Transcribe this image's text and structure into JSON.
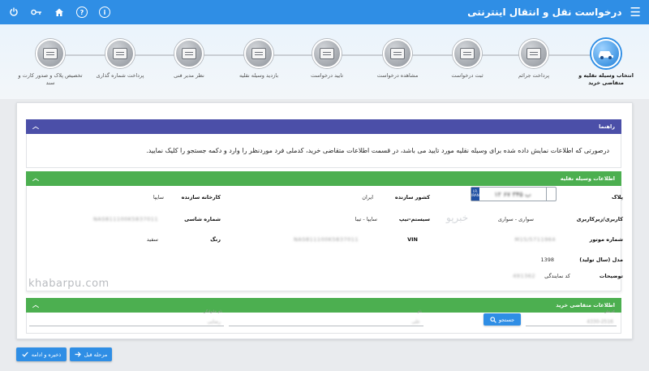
{
  "header": {
    "title": "درخواست نقل و انتقال اینترنتی",
    "menu_icon": "hamburger-icon",
    "icons": [
      "power-icon",
      "key-icon",
      "home-icon",
      "help-icon",
      "info-icon"
    ],
    "help_glyph": "?",
    "info_glyph": "i"
  },
  "steps": [
    {
      "label": "انتخاب وسیله نقلیه و متقاضی خرید",
      "active": true
    },
    {
      "label": "پرداخت جرائم"
    },
    {
      "label": "ثبت درخواست"
    },
    {
      "label": "مشاهده درخواست"
    },
    {
      "label": "تایید درخواست"
    },
    {
      "label": "بازدید وسیله نقلیه"
    },
    {
      "label": "نظر مدیر فنی"
    },
    {
      "label": "پرداخت شماره گذاری"
    },
    {
      "label": "تخصیص پلاک و صدور کارت و سند"
    }
  ],
  "guide": {
    "title": "راهنما",
    "text": "درصورتی که اطلاعات نمایش داده شده برای وسیله نقلیه مورد تایید می باشد، در قسمت اطلاعات متقاضی خرید، کدملی فرد موردنظر را وارد و دکمه جستجو را کلیک نمایید."
  },
  "vehicle": {
    "title": "اطلاعات وسیله نقلیه",
    "plate_label": "پلاک",
    "plate_value": "۱۲ ب ۳۴۵ ۶۷",
    "plate_ir": "I.R.",
    "plate_iran": "IRAN",
    "country_label": "کشور سازنده",
    "country_value": "ایران",
    "manufacturer_label": "کارخانه سازنده",
    "manufacturer_value": "سایپا",
    "usage_label": "کاربری/زیرکاربری",
    "usage_value": "سواری - سواری",
    "system_label": "سیستم-تیپ",
    "system_value": "سایپا - تیبا",
    "chassis_label": "شماره شاسی",
    "chassis_value": "NAS811100K5837011",
    "engine_label": "شماره موتور",
    "engine_value": "M15/5711964",
    "vin_label": "VIN",
    "vin_value": "NAS811100K5837011",
    "color_label": "رنگ",
    "color_value": "سفید",
    "model_label": "مدل (سال تولید)",
    "model_value": "1398",
    "desc_label": "توضیحات",
    "desc_value": "کد نمایندگی",
    "desc_code": "491362"
  },
  "watermark": {
    "fa": "خبرپو",
    "en": "khabarpu.com"
  },
  "buyer": {
    "title": "اطلاعات متقاضی خرید",
    "national_id_placeholder": "کد ملی",
    "national_id_value": "4330-2516",
    "first_name_placeholder": "نام",
    "first_name_value": "علی",
    "last_name_placeholder": "نام خانوادگی",
    "last_name_value": "رضایی",
    "search_label": "جستجو"
  },
  "actions": {
    "save_label": "ذخیره و ادامه",
    "prev_label": "مرحله قبل"
  },
  "colors": {
    "primary": "#2f8ee5",
    "guide_header": "#4b4fa8",
    "section_header": "#4caf50"
  }
}
